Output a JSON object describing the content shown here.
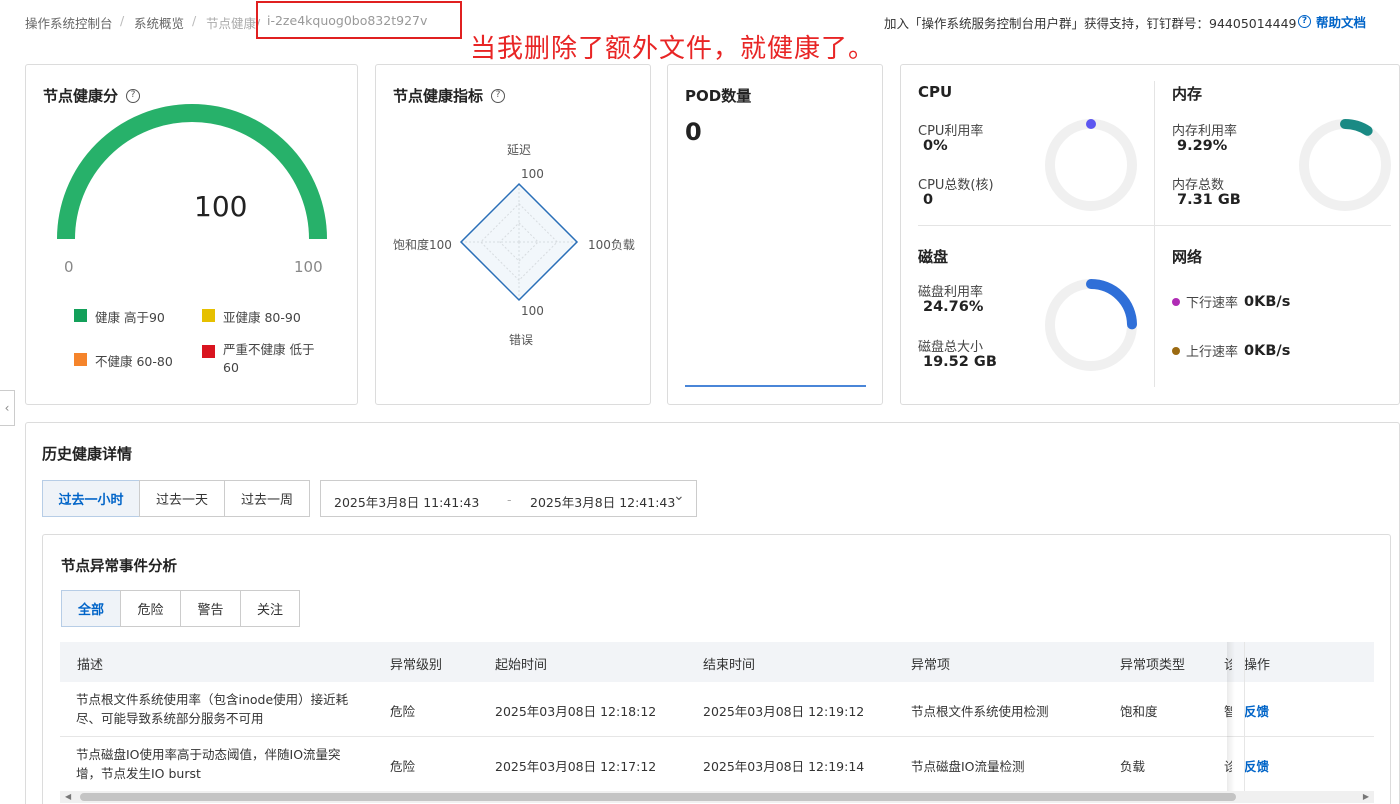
{
  "breadcrumb": {
    "items": [
      "操作系统控制台",
      "系统概览",
      "节点健康/"
    ],
    "instance_id": "i-2ze4kquog0bo832t927v"
  },
  "annotation": {
    "text": "当我删除了额外文件，就健康了。",
    "color": "#e82525"
  },
  "header": {
    "support_text": "加入「操作系统服务控制台用户群」获得支持，钉钉群号：94405014449",
    "help_label": "帮助文档",
    "help_icon": "question-circle-icon"
  },
  "health_score": {
    "title": "节点健康分",
    "score": "100",
    "min": "0",
    "max": "100",
    "fill_fraction": 1.0,
    "color": "#27b16a",
    "legend": [
      {
        "label": "健康 高于90",
        "color": "#13a05a"
      },
      {
        "label": "亚健康 80-90",
        "color": "#e6c000"
      },
      {
        "label": "不健康 60-80",
        "color": "#f5842b"
      },
      {
        "label": "严重不健康 低于60",
        "color": "#d9141f"
      }
    ]
  },
  "health_metrics": {
    "title": "节点健康指标",
    "chart_data": {
      "type": "radar",
      "axes": [
        "延迟",
        "负载",
        "错误",
        "饱和度"
      ],
      "values": [
        100,
        100,
        100,
        100
      ],
      "max": 100,
      "value_labels": [
        "100",
        "100负载",
        "100",
        "饱和度100"
      ]
    }
  },
  "pod": {
    "title": "POD数量",
    "count": "0"
  },
  "resources": {
    "cpu": {
      "title": "CPU",
      "usage_label": "CPU利用率",
      "usage_value": "0%",
      "total_label": "CPU总数(核)",
      "total_value": "0",
      "usage_fraction": 0.0,
      "color": "#5b55f0"
    },
    "memory": {
      "title": "内存",
      "usage_label": "内存利用率",
      "usage_value": "9.29%",
      "total_label": "内存总数",
      "total_value": "7.31 GB",
      "usage_fraction": 0.0929,
      "color": "#1a8a84"
    },
    "disk": {
      "title": "磁盘",
      "usage_label": "磁盘利用率",
      "usage_value": "24.76%",
      "total_label": "磁盘总大小",
      "total_value": "19.52 GB",
      "usage_fraction": 0.2476,
      "color": "#2f6fd8"
    },
    "network": {
      "title": "网络",
      "down_label": "下行速率",
      "down_value": "0KB/s",
      "down_color": "#b02cb5",
      "up_label": "上行速率",
      "up_value": "0KB/s",
      "up_color": "#9b6a12"
    }
  },
  "history": {
    "title": "历史健康详情",
    "ranges": [
      "过去一小时",
      "过去一天",
      "过去一周"
    ],
    "active_range": 0,
    "date_start": "2025年3月8日 11:41:43",
    "date_sep": "-",
    "date_end": "2025年3月8日 12:41:43"
  },
  "events": {
    "title": "节点异常事件分析",
    "tabs": [
      "全部",
      "危险",
      "警告",
      "关注"
    ],
    "active_tab": 0,
    "columns": [
      "描述",
      "异常级别",
      "起始时间",
      "结束时间",
      "异常项",
      "异常项类型",
      "诊",
      "操作"
    ],
    "rows": [
      {
        "desc": "节点根文件系统使用率（包含inode使用）接近耗尽、可能导致系统部分服务不可用",
        "level": "危险",
        "start": "2025年03月08日 12:18:12",
        "end": "2025年03月08日 12:19:12",
        "item": "节点根文件系统使用检测",
        "type": "饱和度",
        "diag": "智",
        "action": "反馈"
      },
      {
        "desc": "节点磁盘IO使用率高于动态阈值，伴随IO流量突增，节点发生IO burst",
        "level": "危险",
        "start": "2025年03月08日 12:17:12",
        "end": "2025年03月08日 12:19:14",
        "item": "节点磁盘IO流量检测",
        "type": "负载",
        "diag": "诊",
        "action": "反馈"
      }
    ]
  }
}
